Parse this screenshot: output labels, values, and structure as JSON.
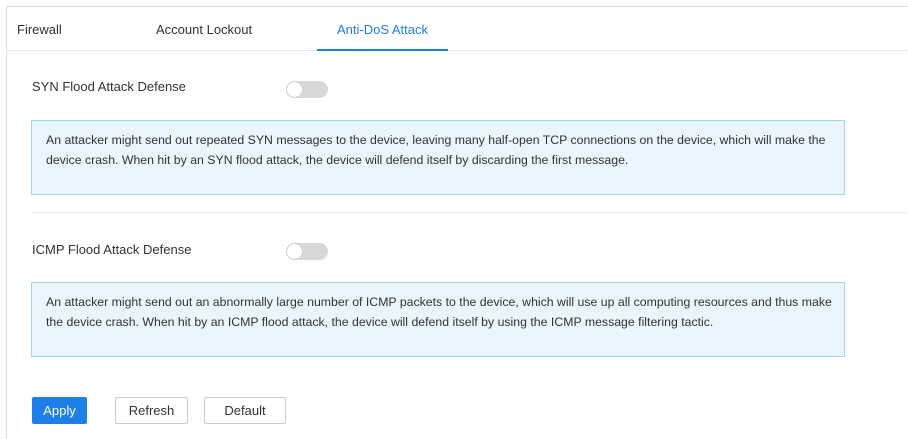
{
  "tabs": [
    {
      "label": "Firewall",
      "active": false
    },
    {
      "label": "Account Lockout",
      "active": false
    },
    {
      "label": "Anti-DoS Attack",
      "active": true
    }
  ],
  "syn": {
    "label": "SYN Flood Attack Defense",
    "enabled": false,
    "description": "An attacker might send out repeated SYN messages to the device, leaving many half-open TCP connections on the device, which will make the device crash. When hit by an SYN flood attack, the device will defend itself by discarding the first message."
  },
  "icmp": {
    "label": "ICMP Flood Attack Defense",
    "enabled": false,
    "description": "An attacker might send out an abnormally large number of ICMP packets to the device, which will use up all computing resources and thus make the device crash. When hit by an ICMP flood attack, the device will defend itself by using the ICMP message filtering tactic."
  },
  "buttons": {
    "apply": "Apply",
    "refresh": "Refresh",
    "default": "Default"
  },
  "colors": {
    "accent": "#1e7fe8",
    "info_background": "#e9f6fd",
    "info_border": "#9fd6f2",
    "toggle_off": "#d8d8d8"
  }
}
